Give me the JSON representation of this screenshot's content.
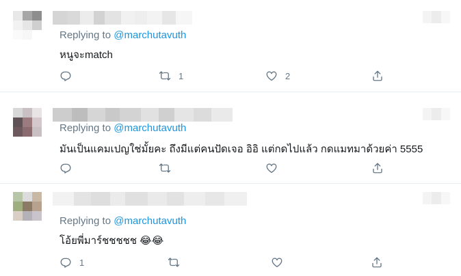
{
  "tweets": [
    {
      "replying_prefix": "Replying to",
      "handle": "@marchutavuth",
      "text": "หนูจะmatch",
      "counts": {
        "reply": "",
        "retweet": "1",
        "like": "2"
      },
      "avatar_colors": [
        "#e8e8e8",
        "#a6a6a6",
        "#8e8e8e",
        "#f2f2f2",
        "#e6e6e6",
        "#cfcfcf",
        "#fafafa",
        "#f7f7f7",
        "#ffffff"
      ],
      "name_colors": [
        "#d5d5d5",
        "#d9d9d9",
        "#ececec",
        "#d2d2d2",
        "#e3e3e3",
        "#f1f1f1",
        "#eeeeee",
        "#f3f3f3",
        "#e6e6e6",
        "#f6f6f6"
      ]
    },
    {
      "replying_prefix": "Replying to",
      "handle": "@marchutavuth",
      "text": "มันเป็นแคมเปญใช่มั้ยคะ ถึงมีแต่คนปัดเจอ อิอิ แต่กดไปแล้ว กดแมทมาด้วยค่า 5555",
      "counts": {
        "reply": "",
        "retweet": "",
        "like": ""
      },
      "avatar_colors": [
        "#d8d8d8",
        "#c9c0c4",
        "#e8e4e6",
        "#5f5357",
        "#9b7a80",
        "#d4c8cc",
        "#6e5a5e",
        "#8b6b70",
        "#c8c0c2"
      ],
      "name_colors": [
        "#cdcdcd",
        "#bdbdbd",
        "#d6d6d6",
        "#c9c9c9",
        "#d3d3d3",
        "#e1e1e1",
        "#d0d0d0",
        "#e5e5e5",
        "#dcdcdc",
        "#eaeaea"
      ]
    },
    {
      "replying_prefix": "Replying to",
      "handle": "@marchutavuth",
      "text": "โอ้ยพี่มาร์ชชชชช 😂😂",
      "counts": {
        "reply": "1",
        "retweet": "",
        "like": ""
      },
      "avatar_colors": [
        "#b8c6a8",
        "#dcdcdc",
        "#c9b8a4",
        "#9fae7e",
        "#8b7a66",
        "#b7a28e",
        "#d9cfc5",
        "#b4b2b8",
        "#c9c4cc"
      ],
      "name_colors": [
        "#f2f2f2",
        "#e4e4e4",
        "#dedede",
        "#ebebeb",
        "#e0e0e0",
        "#eaeaea",
        "#e2e2e2",
        "#eeeeee",
        "#e7e7e7",
        "#f0f0f0"
      ]
    }
  ],
  "colors": {
    "muted": "#657786",
    "link": "#1b95e0",
    "divider": "#e6ecf0"
  },
  "icons": [
    "reply-icon",
    "retweet-icon",
    "like-icon",
    "share-icon"
  ]
}
